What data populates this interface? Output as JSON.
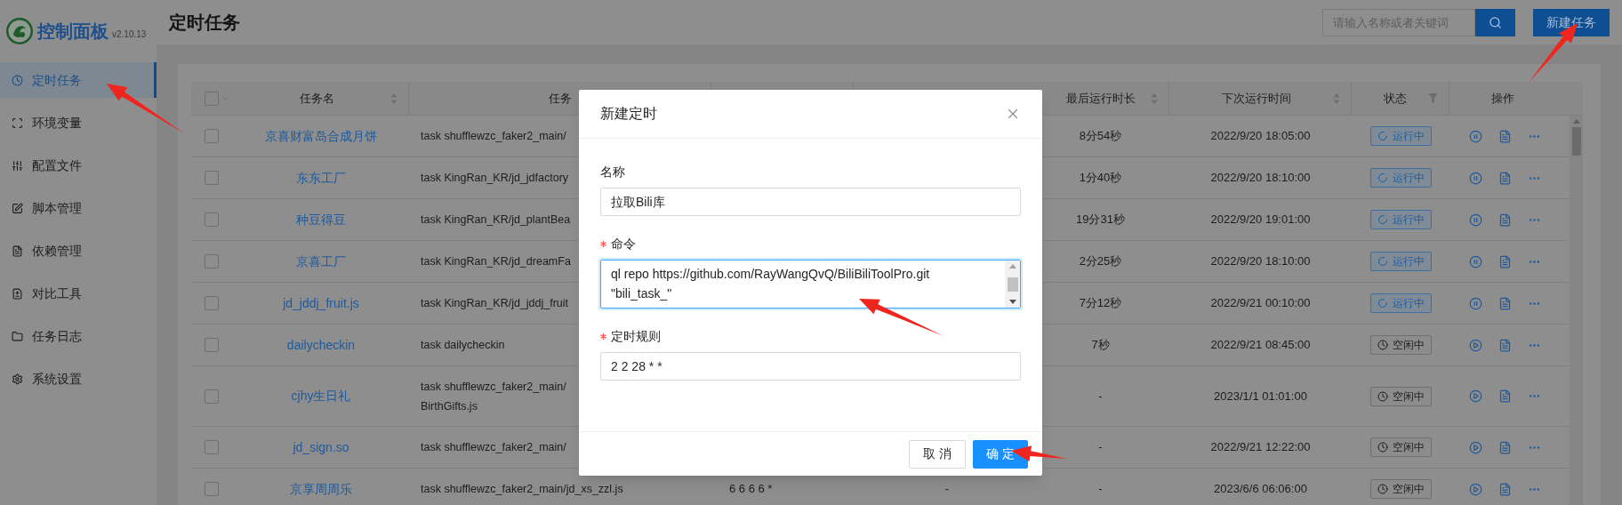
{
  "sidebar": {
    "logo_title": "控制面板",
    "version": "v2.10.13",
    "items": [
      {
        "label": "定时任务",
        "selected": true
      },
      {
        "label": "环境变量",
        "selected": false
      },
      {
        "label": "配置文件",
        "selected": false
      },
      {
        "label": "脚本管理",
        "selected": false
      },
      {
        "label": "依赖管理",
        "selected": false
      },
      {
        "label": "对比工具",
        "selected": false
      },
      {
        "label": "任务日志",
        "selected": false
      },
      {
        "label": "系统设置",
        "selected": false
      }
    ]
  },
  "header": {
    "title": "定时任务",
    "search": {
      "placeholder": "请输入名称或者关键词"
    },
    "new_button": "新建任务"
  },
  "table": {
    "all_checked": false,
    "columns": [
      {
        "label": "任务名",
        "sortable": true,
        "filter": false
      },
      {
        "label": "任务",
        "sortable": false,
        "filter": false
      },
      {
        "label": "最后运行时长",
        "sortable": true,
        "filter": false
      },
      {
        "label": "下次运行时间",
        "sortable": true,
        "filter": false
      },
      {
        "label": "状态",
        "sortable": false,
        "filter": true
      },
      {
        "label": "操作",
        "sortable": false,
        "filter": false
      }
    ],
    "rows": [
      {
        "checked": false,
        "name": "京喜财富岛合成月饼",
        "task": [
          "task shufflewzc_faker2_main/"
        ],
        "duration": "8分54秒",
        "next_run": "2022/9/20 18:05:00",
        "status": {
          "kind": "running",
          "label": "运行中"
        }
      },
      {
        "checked": false,
        "name": "东东工厂",
        "task": [
          "task KingRan_KR/jd_jdfactory"
        ],
        "duration": "1分40秒",
        "next_run": "2022/9/20 18:10:00",
        "status": {
          "kind": "running",
          "label": "运行中"
        }
      },
      {
        "checked": false,
        "name": "种豆得豆",
        "task": [
          "task KingRan_KR/jd_plantBea"
        ],
        "duration": "19分31秒",
        "next_run": "2022/9/20 19:01:00",
        "status": {
          "kind": "running",
          "label": "运行中"
        }
      },
      {
        "checked": false,
        "name": "京喜工厂",
        "task": [
          "task KingRan_KR/jd_dreamFa"
        ],
        "duration": "2分25秒",
        "next_run": "2022/9/20 18:10:00",
        "status": {
          "kind": "running",
          "label": "运行中"
        }
      },
      {
        "checked": false,
        "name": "jd_jddj_fruit.js",
        "task": [
          "task KingRan_KR/jd_jddj_fruit"
        ],
        "duration": "7分12秒",
        "next_run": "2022/9/21 00:10:00",
        "status": {
          "kind": "running",
          "label": "运行中"
        }
      },
      {
        "checked": false,
        "name": "dailycheckin",
        "task": [
          "task dailycheckin"
        ],
        "duration": "7秒",
        "next_run": "2022/9/21 08:45:00",
        "status": {
          "kind": "idle",
          "label": "空闲中"
        }
      },
      {
        "checked": false,
        "name": "cjhy生日礼",
        "task": [
          "task shufflewzc_faker2_main/",
          "BirthGifts.js"
        ],
        "duration": "-",
        "next_run": "2023/1/1 01:01:00",
        "status": {
          "kind": "idle",
          "label": "空闲中"
        }
      },
      {
        "checked": false,
        "name": "jd_sign.so",
        "task": [
          "task shufflewzc_faker2_main/"
        ],
        "duration": "-",
        "next_run": "2022/9/21 12:22:00",
        "status": {
          "kind": "idle",
          "label": "空闲中"
        }
      },
      {
        "checked": false,
        "name": "京享周周乐",
        "task": [
          "task shufflewzc_faker2_main/jd_xs_zzl.js"
        ],
        "rule": "6 6 6 6 *",
        "last_run": "-",
        "duration": "-",
        "next_run": "2023/6/6 06:06:00",
        "status": {
          "kind": "idle",
          "label": "空闲中"
        }
      }
    ]
  },
  "modal": {
    "title": "新建定时",
    "fields": [
      {
        "kind": "input",
        "label": "名称",
        "required": false,
        "focused": false,
        "value": "拉取Bili库"
      },
      {
        "kind": "textarea",
        "label": "命令",
        "required": true,
        "focused": true,
        "value": "ql repo https://github.com/RayWangQvQ/BiliBiliToolPro.git\n\"bili_task_\""
      },
      {
        "kind": "input",
        "label": "定时规则",
        "required": true,
        "focused": false,
        "value": "2 2 28 * *"
      }
    ],
    "buttons": {
      "cancel": "取 消",
      "ok": "确 定"
    }
  }
}
